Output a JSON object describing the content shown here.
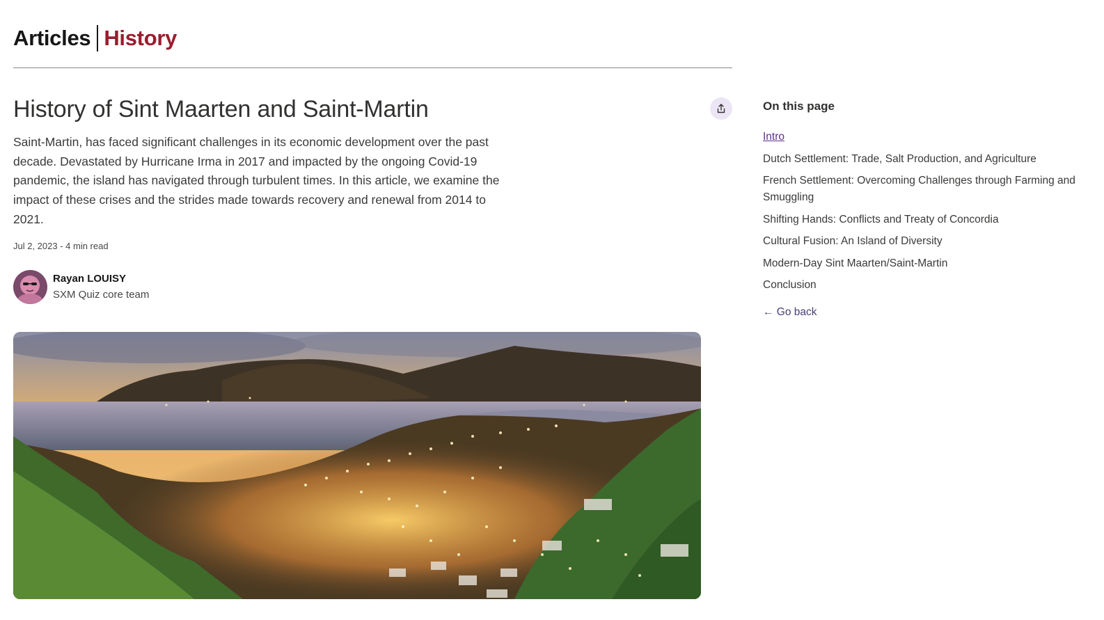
{
  "header": {
    "section": "Articles",
    "category": "History"
  },
  "article": {
    "title": "History of Sint Maarten and Saint-Martin",
    "summary": "Saint-Martin, has faced significant challenges in its economic development over the past decade. Devastated by Hurricane Irma in 2017 and impacted by the ongoing Covid-19 pandemic, the island has navigated through turbulent times. In this article, we examine the impact of these crises and the strides made towards recovery and renewal from 2014 to 2021.",
    "meta": "Jul 2, 2023 - 4 min read",
    "share_icon": "share-icon"
  },
  "author": {
    "name": "Rayan LOUISY",
    "team": "SXM Quiz core team"
  },
  "toc": {
    "title": "On this page",
    "items": [
      "Intro",
      "Dutch Settlement: Trade, Salt Production, and Agriculture",
      "French Settlement: Overcoming Challenges through Farming and Smuggling",
      "Shifting Hands: Conflicts and Treaty of Concordia",
      "Cultural Fusion: An Island of Diversity",
      "Modern-Day Sint Maarten/Saint-Martin",
      "Conclusion"
    ],
    "go_back": "← Go back"
  },
  "colors": {
    "accent_red": "#9b1c2e",
    "link_purple": "#5c2e91",
    "share_bg": "#ece5f5"
  }
}
